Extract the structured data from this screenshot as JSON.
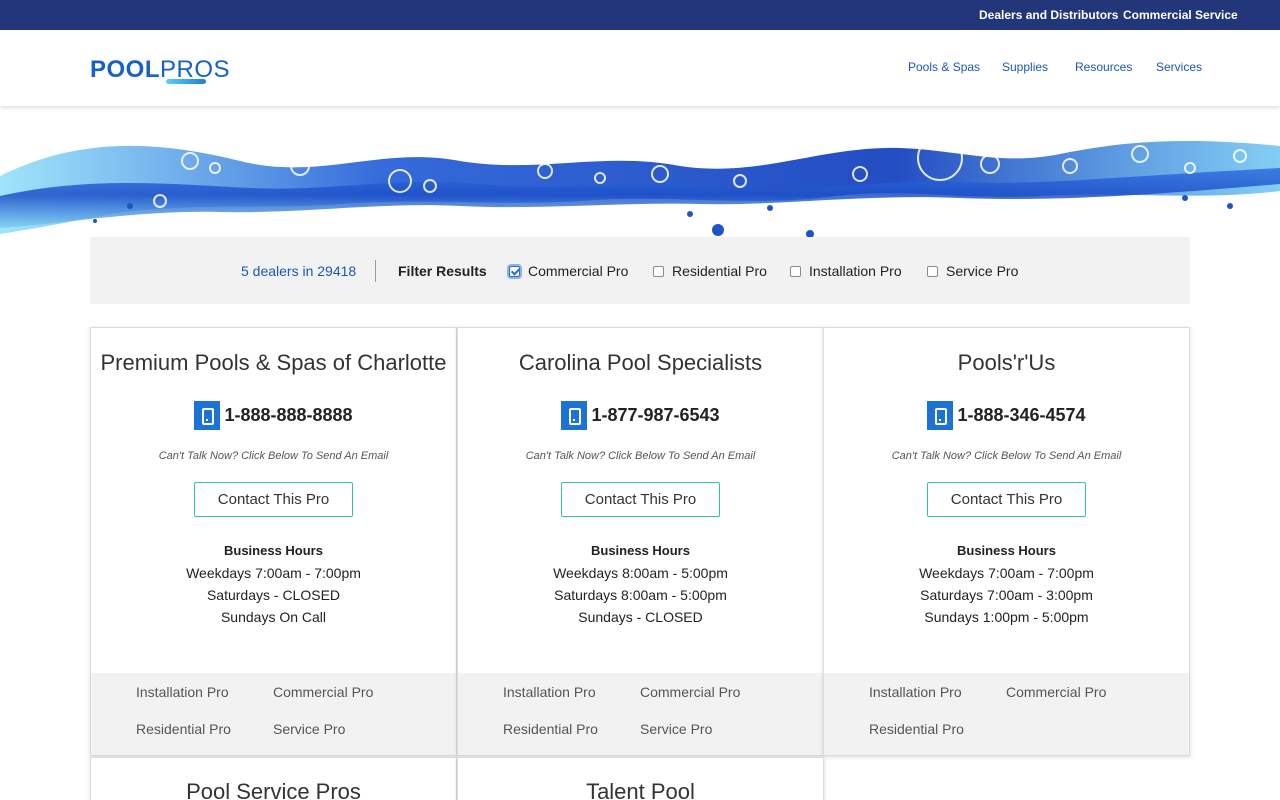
{
  "topbar": {
    "dealers_link": "Dealers and Distributors",
    "commercial_link": "Commercial Service"
  },
  "header": {
    "logo_pool": "POOL",
    "logo_pros": "PROS",
    "nav": {
      "pools_spas": "Pools & Spas",
      "supplies": "Supplies",
      "resources": "Resources",
      "services": "Services"
    }
  },
  "filters": {
    "results_count": "5 dealers in 29418",
    "label": "Filter Results",
    "options": [
      {
        "label": "Commercial Pro",
        "checked": true
      },
      {
        "label": "Residential Pro",
        "checked": false
      },
      {
        "label": "Installation Pro",
        "checked": false
      },
      {
        "label": "Service Pro",
        "checked": false
      }
    ]
  },
  "card_common": {
    "cta_note": "Can't Talk Now? Click Below To Send An Email",
    "contact_label": "Contact This Pro",
    "hours_title": "Business Hours"
  },
  "dealers": [
    {
      "name": "Premium Pools & Spas of Charlotte",
      "phone": "1-888-888-8888",
      "hours": [
        "Weekdays 7:00am - 7:00pm",
        "Saturdays - CLOSED",
        "Sundays On Call"
      ],
      "tags": [
        "Installation Pro",
        "Commercial Pro",
        "Residential Pro",
        "Service Pro"
      ]
    },
    {
      "name": "Carolina Pool Specialists",
      "phone": "1-877-987-6543",
      "hours": [
        "Weekdays 8:00am - 5:00pm",
        "Saturdays 8:00am - 5:00pm",
        "Sundays - CLOSED"
      ],
      "tags": [
        "Installation Pro",
        "Commercial Pro",
        "Residential Pro",
        "Service Pro"
      ]
    },
    {
      "name": "Pools'r'Us",
      "phone": "1-888-346-4574",
      "hours": [
        "Weekdays 7:00am - 7:00pm",
        "Saturdays 7:00am - 3:00pm",
        "Sundays 1:00pm - 5:00pm"
      ],
      "tags": [
        "Installation Pro",
        "Commercial Pro",
        "Residential Pro"
      ]
    },
    {
      "name": "Pool Service Pros"
    },
    {
      "name": "Talent Pool"
    }
  ],
  "colors": {
    "topbar": "#23367a",
    "brand_blue": "#1660c9",
    "nav_link": "#1a57b8",
    "button_border": "#2fc3a9",
    "phone_icon": "#1d72d6",
    "panel_gray": "#f2f2f2"
  }
}
